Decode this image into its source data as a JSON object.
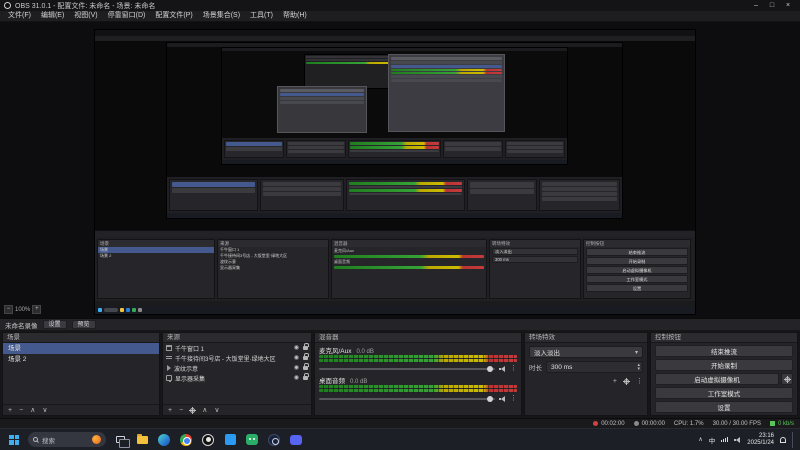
{
  "titlebar": {
    "title": "OBS 31.0.1 - 配置文件: 未命名 - 场景: 未命名"
  },
  "menubar": {
    "items": [
      "文件(F)",
      "编辑(E)",
      "视图(V)",
      "停靠窗口(D)",
      "配置文件(P)",
      "场景集合(S)",
      "工具(T)",
      "帮助(H)"
    ]
  },
  "preview": {
    "zoom": "100%"
  },
  "source_toolbar": {
    "label": "未命名录像",
    "buttons": [
      "设置",
      "预览"
    ]
  },
  "docks": {
    "scenes": {
      "title": "场景",
      "items": [
        "场景",
        "场景 2"
      ]
    },
    "sources": {
      "title": "来源",
      "items": [
        "千牛窗口 1",
        "千牛接待间3号店 - 大饭堂里·绿地大区",
        "波纹示意",
        "显示器采集"
      ]
    },
    "mixer": {
      "title": "混音器",
      "channels": [
        {
          "name": "麦克风/Aux",
          "db": "0.0 dB",
          "level": 0.95
        },
        {
          "name": "桌面音频",
          "db": "0.0 dB",
          "level": 0.95
        }
      ]
    },
    "transitions": {
      "title": "转场特效",
      "selected": "淡入淡出",
      "duration_label": "时长",
      "duration": "300 ms"
    },
    "controls": {
      "title": "控制按钮",
      "buttons": [
        "结束推流",
        "开始录制",
        "启动虚拟摄像机",
        "工作室模式",
        "设置"
      ]
    }
  },
  "statusbar": {
    "stream_time": "00:02:00",
    "rec_time": "00:00:00",
    "cpu": "CPU: 1.7%",
    "fps": "30.00 / 30.00 FPS",
    "bitrate": "0 kb/s"
  },
  "taskbar": {
    "search": "搜索",
    "input_method": "中",
    "time": "23:16",
    "date": "2025/1/24"
  },
  "glyphs": {
    "minimize": "–",
    "maximize": "□",
    "close": "×",
    "dropdown": "▾",
    "spin_up": "▴",
    "spin_down": "▾",
    "plus": "+",
    "minus": "−",
    "up": "∧",
    "down": "∨",
    "more": "⋮",
    "eye": "◉",
    "zoom_in": "+",
    "zoom_out": "−",
    "tray_chevron": "∧"
  },
  "colors": {
    "selection": "#44598e",
    "meter_green": "#36a336",
    "meter_yellow": "#cdbb00",
    "meter_red": "#c33b3b",
    "live_dot": "#d04343",
    "start_blue": "#3fb0ef"
  }
}
